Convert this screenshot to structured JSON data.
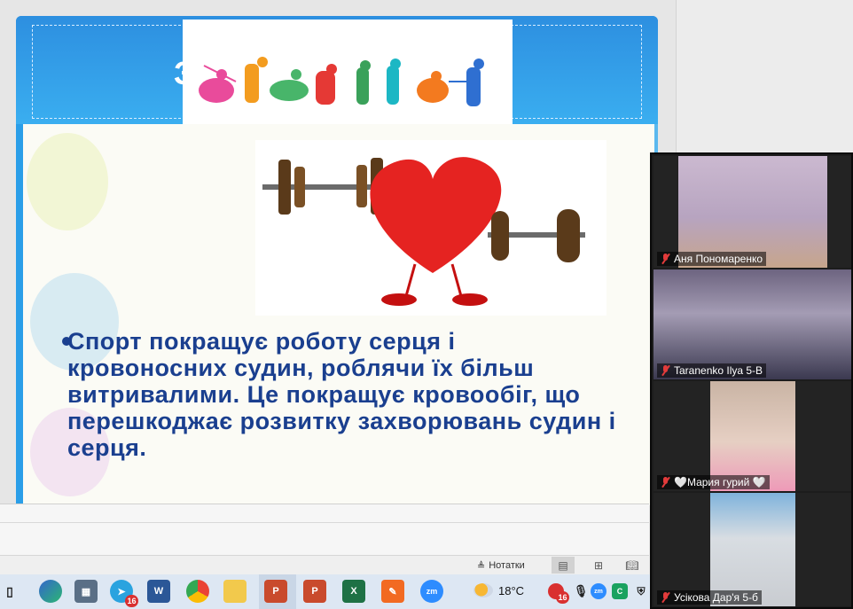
{
  "slide": {
    "title_partial": "З",
    "bullet_text": "Спорт покращує роботу серця і кровоносних судин, роблячи їх більш витривалими. Це покращує кровообіг, що перешкоджає розвитку захворювань судин і серця."
  },
  "status_bar": {
    "notes_label": "Нотатки"
  },
  "participants": [
    {
      "name": "Аня Пономаренко",
      "muted": true
    },
    {
      "name": "Taranenko Ilya 5-В",
      "muted": true
    },
    {
      "name": "🤍Мария гурий 🤍",
      "muted": true
    },
    {
      "name": "Усікова Дар'я 5-б",
      "muted": true
    }
  ],
  "taskbar": {
    "telegram_badge": "16",
    "tray_badge": "16",
    "temperature": "18°C",
    "icons": [
      "task-view-icon",
      "edge-icon",
      "calculator-icon",
      "telegram-icon",
      "word-icon",
      "chrome-icon",
      "file-explorer-icon",
      "powerpoint-icon",
      "powerpoint-icon-2",
      "excel-icon",
      "draw-app-icon",
      "zoom-icon"
    ]
  },
  "colors": {
    "slide_blue": "#2a9ee8",
    "text_blue": "#1a3f8f",
    "muted_red": "#e23b3b"
  }
}
